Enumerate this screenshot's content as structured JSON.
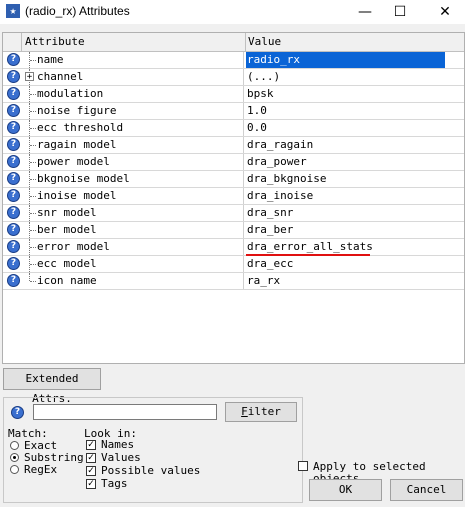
{
  "window": {
    "title": "(radio_rx) Attributes",
    "minimize_glyph": "—",
    "maximize_glyph": "☐",
    "close_glyph": "✕"
  },
  "table": {
    "columns": [
      "Attribute",
      "Value"
    ],
    "rows": [
      {
        "name": "name",
        "value": "radio_rx",
        "selected": true
      },
      {
        "name": "channel",
        "value": "(...)",
        "expandable": true
      },
      {
        "name": "modulation",
        "value": "bpsk"
      },
      {
        "name": "noise figure",
        "value": "1.0"
      },
      {
        "name": "ecc threshold",
        "value": "0.0"
      },
      {
        "name": "ragain model",
        "value": "dra_ragain"
      },
      {
        "name": "power model",
        "value": "dra_power"
      },
      {
        "name": "bkgnoise model",
        "value": "dra_bkgnoise"
      },
      {
        "name": "inoise model",
        "value": "dra_inoise"
      },
      {
        "name": "snr model",
        "value": "dra_snr"
      },
      {
        "name": "ber model",
        "value": "dra_ber"
      },
      {
        "name": "error model",
        "value": "dra_error_all_stats",
        "annotation": "red-underline"
      },
      {
        "name": "ecc model",
        "value": "dra_ecc"
      },
      {
        "name": "icon name",
        "value": "ra_rx"
      }
    ]
  },
  "extended_attrs_button": "Extended Attrs.",
  "filter": {
    "input_value": "",
    "button_label": "Filter",
    "match_label": "Match:",
    "match_options": [
      {
        "label": "Exact",
        "checked": false
      },
      {
        "label": "Substring",
        "checked": true
      },
      {
        "label": "RegEx",
        "checked": false
      }
    ],
    "look_in_label": "Look in:",
    "look_in_options": [
      {
        "label": "Names",
        "checked": true
      },
      {
        "label": "Values",
        "checked": true
      },
      {
        "label": "Possible values",
        "checked": true
      },
      {
        "label": "Tags",
        "checked": true
      }
    ]
  },
  "apply_to_selected": {
    "label": "Apply to selected objects",
    "checked": false
  },
  "ok_button": "OK",
  "cancel_button": "Cancel",
  "colors": {
    "selection": "#0a64d6",
    "annotation": "#e01010",
    "help_icon": "#3a6fcf"
  }
}
